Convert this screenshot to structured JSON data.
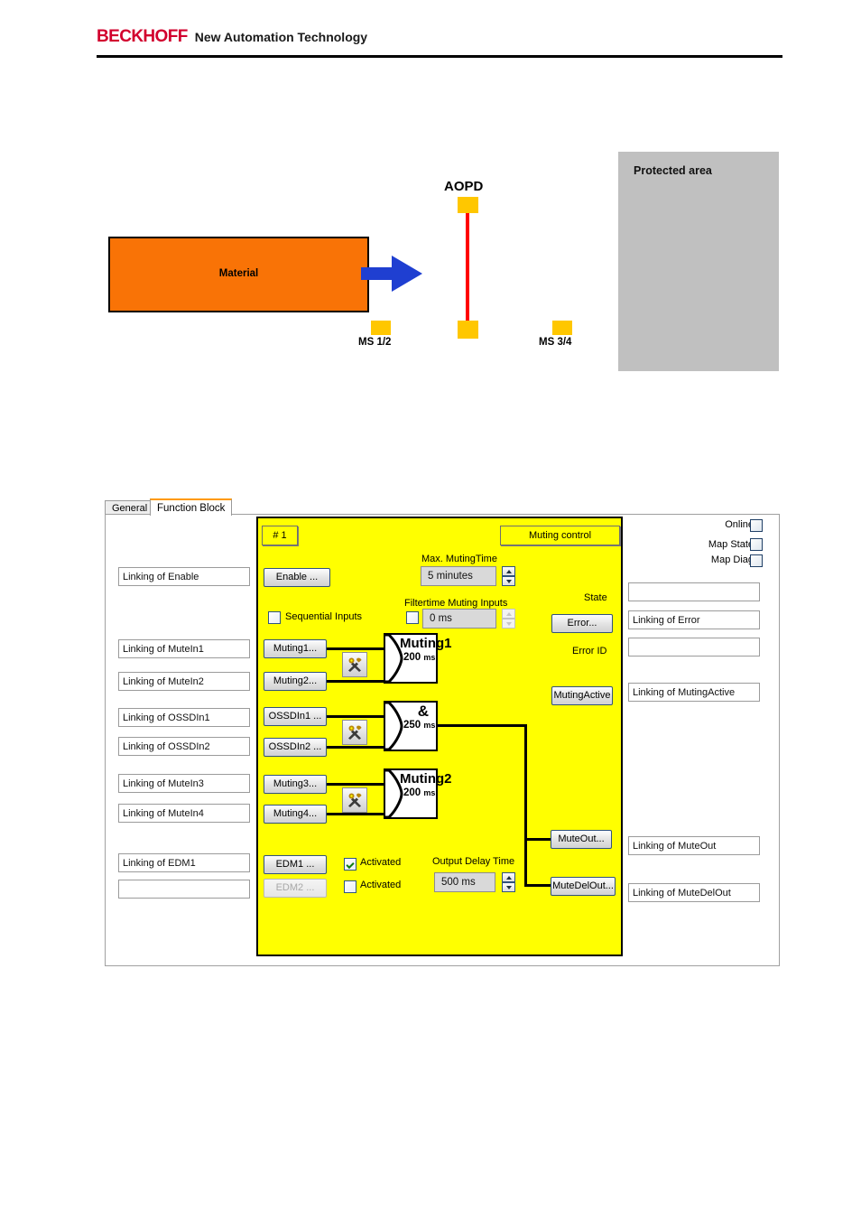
{
  "header": {
    "brand": "BECKHOFF",
    "tagline": "New Automation Technology"
  },
  "diagram": {
    "protected_area_label": "Protected area",
    "material_label": "Material",
    "aopd_label": "AOPD",
    "ms12_label": "MS 1/2",
    "ms34_label": "MS 3/4",
    "colors": {
      "material": "#f97306",
      "sensor": "#ffc700",
      "beam": "#ff0000",
      "arrow": "#1f3fd1",
      "protected_area": "#c0c0c0"
    }
  },
  "dialog": {
    "tabs": [
      {
        "label": "General",
        "active": false
      },
      {
        "label": "Function Block",
        "active": true
      }
    ],
    "left_links": [
      "Linking of Enable",
      "Linking of MuteIn1",
      "Linking of MuteIn2",
      "Linking of OSSDIn1",
      "Linking of OSSDIn2",
      "Linking of MuteIn3",
      "Linking of MuteIn4",
      "Linking of EDM1",
      ""
    ],
    "right_links": [
      "",
      "Linking of Error",
      "",
      "Linking of MutingActive",
      "Linking of MuteOut",
      "Linking of MuteDelOut"
    ],
    "right_checks": [
      {
        "label": "Online",
        "checked": false
      },
      {
        "label": "Map State",
        "checked": false
      },
      {
        "label": "Map Diag",
        "checked": false
      }
    ],
    "fb": {
      "index_button": "# 1",
      "title_button": "Muting control",
      "enable_button": "Enable ...",
      "sequential_inputs": {
        "label": "Sequential Inputs",
        "checked": false
      },
      "max_muting_time": {
        "label": "Max. MutingTime",
        "value": "5 minutes"
      },
      "filtertime": {
        "label": "Filtertime Muting Inputs",
        "value": "0 ms",
        "checked": false,
        "enabled": false
      },
      "input_buttons": [
        "Muting1...",
        "Muting2...",
        "OSSDIn1 ...",
        "OSSDIn2 ...",
        "Muting3...",
        "Muting4..."
      ],
      "edm": [
        {
          "label": "EDM1 ...",
          "enabled": true,
          "activated_label": "Activated",
          "activated": true
        },
        {
          "label": "EDM2 ...",
          "enabled": false,
          "activated_label": "Activated",
          "activated": false
        }
      ],
      "output_delay": {
        "label": "Output Delay Time",
        "value": "500 ms"
      },
      "gates": [
        {
          "name": "Muting1",
          "time": "200",
          "unit": "ms"
        },
        {
          "name": "&",
          "time": "250",
          "unit": "ms"
        },
        {
          "name": "Muting2",
          "time": "200",
          "unit": "ms"
        }
      ],
      "state_label": "State",
      "error_button": "Error...",
      "error_id_label": "Error ID",
      "muting_active_button": "MutingActive",
      "mute_out_button": "MuteOut...",
      "mute_del_out_button": "MuteDelOut..."
    }
  }
}
